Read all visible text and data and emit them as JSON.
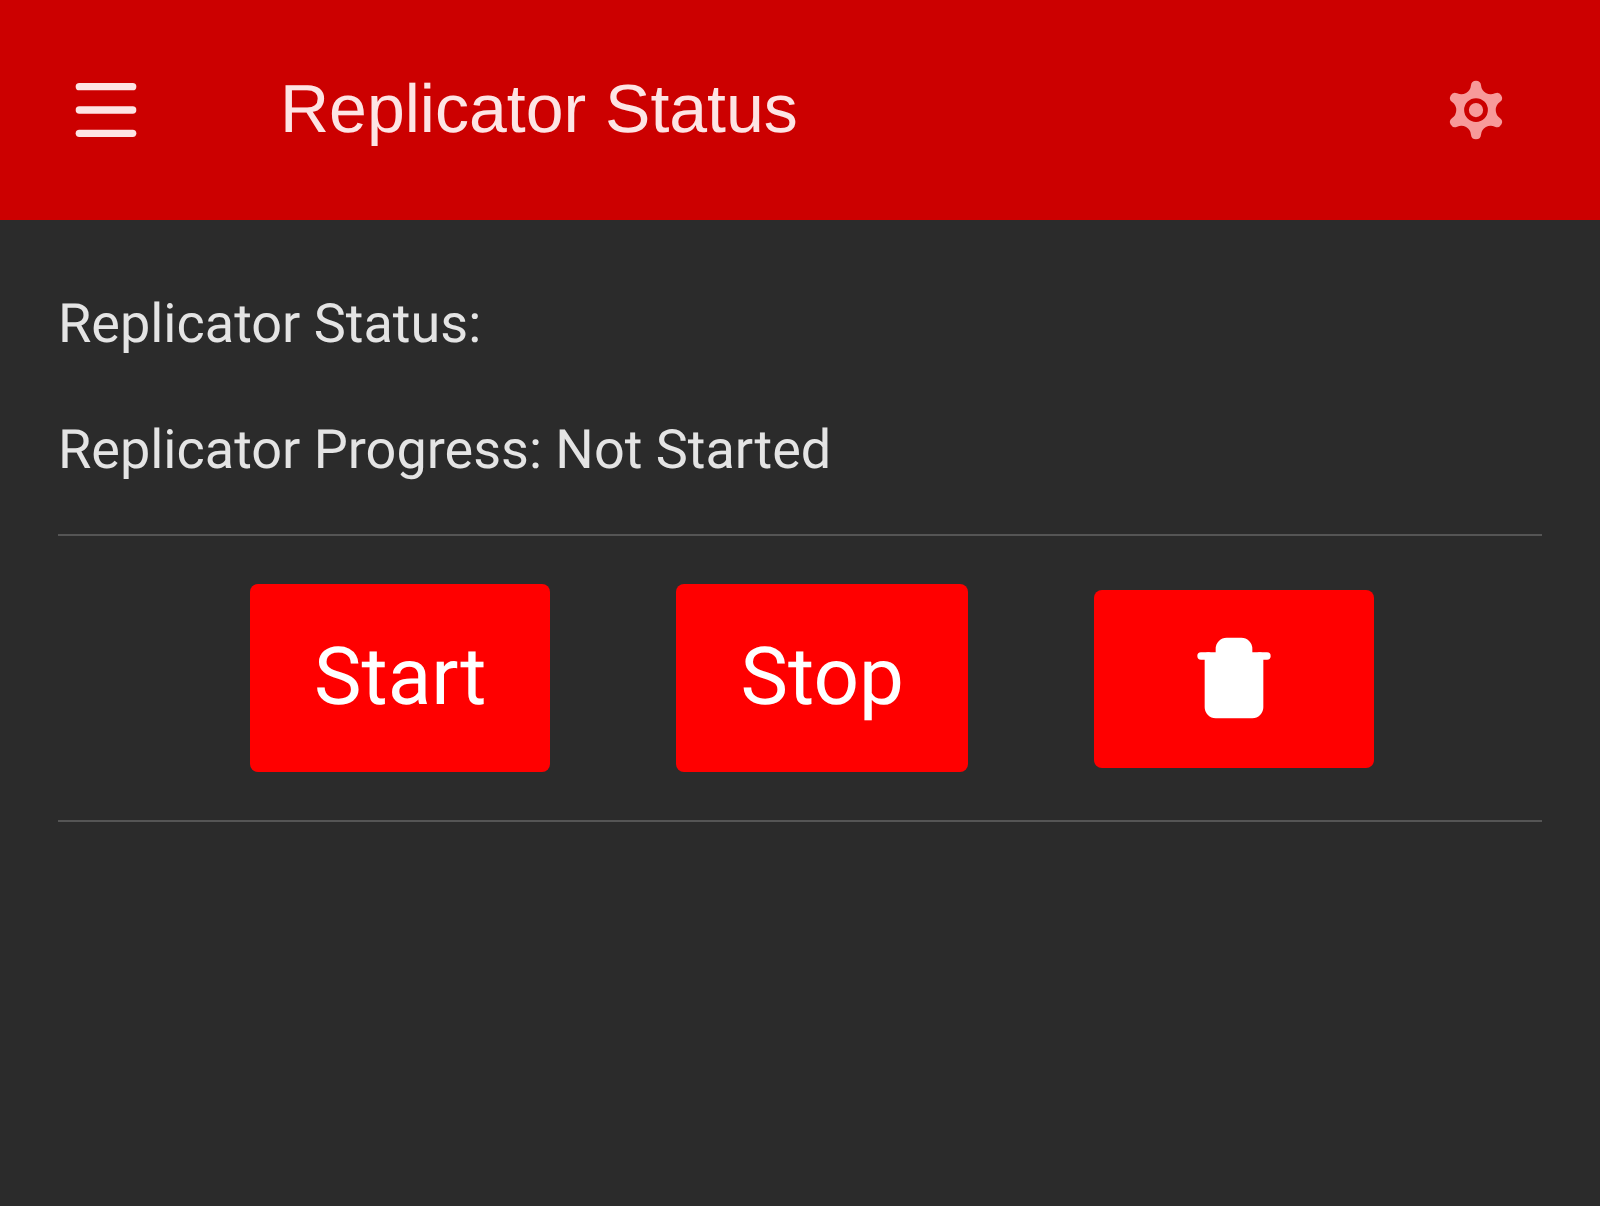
{
  "app_bar": {
    "title": "Replicator Status"
  },
  "status_lines": [
    "Replicator Status:",
    "Replicator Progress: Not Started"
  ],
  "buttons": [
    {
      "kind": "text",
      "label": "Start"
    },
    {
      "kind": "text",
      "label": "Stop"
    },
    {
      "kind": "icon"
    }
  ]
}
